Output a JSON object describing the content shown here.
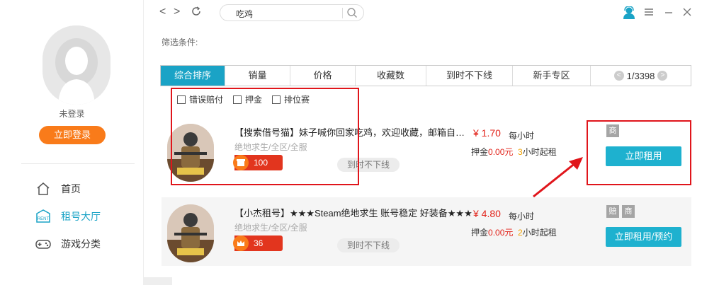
{
  "sidebar": {
    "guest_label": "未登录",
    "login_button": "立即登录",
    "nav": [
      {
        "label": "首页",
        "icon": "home-icon"
      },
      {
        "label": "租号大厅",
        "icon": "rent-icon"
      },
      {
        "label": "游戏分类",
        "icon": "gamepad-icon"
      }
    ]
  },
  "topbar": {
    "search_value": "吃鸡",
    "icons": [
      "back-icon",
      "forward-icon",
      "refresh-icon",
      "search-icon",
      "user-icon",
      "menu-icon",
      "minimize-icon",
      "close-icon"
    ]
  },
  "filter": {
    "label": "筛选条件:",
    "tabs": [
      "综合排序",
      "销量",
      "价格",
      "收藏数",
      "到时不下线",
      "新手专区"
    ],
    "active_tab": 0,
    "pager": "1/3398",
    "checkboxes": [
      "错误赔付",
      "押金",
      "排位赛"
    ]
  },
  "listings": [
    {
      "title": "【搜索借号猫】妹子喊你回家吃鸡，欢迎收藏，邮箱自…",
      "subtitle": "绝地求生/全区/全服",
      "rating": "100",
      "rating_icon": "shop-icon",
      "tag": "到时不下线",
      "price": "¥ 1.70",
      "per": "每小时",
      "deposit_label": "押金",
      "deposit_value": "0.00元",
      "min_hours": "3",
      "min_suffix": "小时起租",
      "badges": [
        "商"
      ],
      "button": "立即租用"
    },
    {
      "title": "【小杰租号】★★★Steam绝地求生 账号稳定 好装备★★★",
      "subtitle": "绝地求生/全区/全服",
      "rating": "36",
      "rating_icon": "crown-icon",
      "tag": "到时不下线",
      "price": "¥ 4.80",
      "per": "每小时",
      "deposit_label": "押金",
      "deposit_value": "0.00元",
      "min_hours": "2",
      "min_suffix": "小时起租",
      "badges": [
        "赔",
        "商"
      ],
      "button": "立即租用/预约"
    }
  ],
  "colors": {
    "accent": "#1aa3c6",
    "login": "#f97b1a",
    "price": "#e2231a",
    "annotation": "#e0151b"
  }
}
